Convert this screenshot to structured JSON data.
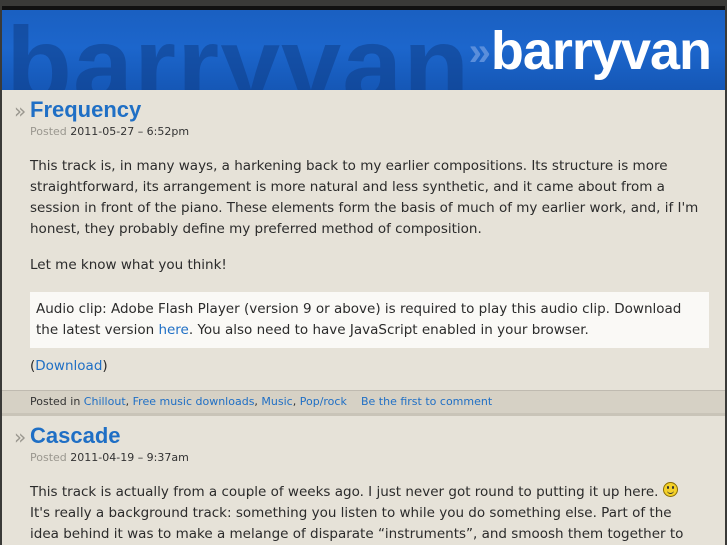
{
  "site": {
    "ghost_text": "barryvan",
    "title": "barryvan",
    "title_prefix": "»"
  },
  "posts": [
    {
      "bullet": "»",
      "title": "Frequency",
      "posted_label": "Posted",
      "datetime": "2011-05-27 – 6:52pm",
      "paragraphs": [
        "This track is, in many ways, a harkening back to my earlier compositions. Its structure is more straightforward, its arrangement is more natural and less synthetic, and it came about from a session in front of the piano. These elements form the basis of much of my earlier work, and, if I'm honest, they probably define my preferred method of composition.",
        "Let me know what you think!"
      ],
      "audio": {
        "text_before": "Audio clip: Adobe Flash Player (version 9 or above) is required to play this audio clip. Download the latest version ",
        "link": "here",
        "text_after": ". You also need to have JavaScript enabled in your browser."
      },
      "download": {
        "open": "(",
        "link": "Download",
        "close": ")"
      },
      "footer": {
        "posted_in": "Posted in",
        "categories": [
          "Chillout",
          "Free music downloads",
          "Music",
          "Pop/rock"
        ],
        "comment_link": "Be the first to comment"
      }
    },
    {
      "bullet": "»",
      "title": "Cascade",
      "posted_label": "Posted",
      "datetime": "2011-04-19 – 9:37am",
      "paragraph_before_smiley": "This track is actually from a couple of weeks ago. I just never got round to putting it up here. ",
      "paragraph_after_smiley": " It's really a background track: something you listen to while you do something else. Part of the idea behind it was to make a melange of disparate “instruments”, and smoosh them together to make something that's coherent."
    }
  ],
  "colors": {
    "link": "#1f6fc5",
    "header_blue": "#1c66cc",
    "page_bg": "#e6e2d8"
  }
}
